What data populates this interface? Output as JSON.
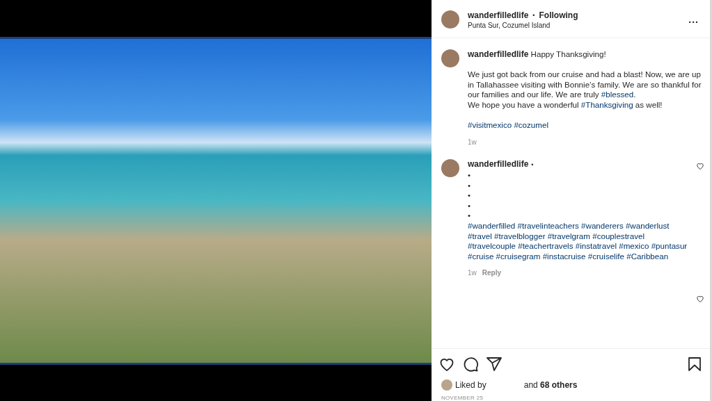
{
  "header": {
    "username": "wanderfilledlife",
    "separator": "•",
    "follow_status": "Following",
    "location": "Punta Sur, Cozumel Island",
    "menu": "..."
  },
  "comments": [
    {
      "username": "wanderfilledlife",
      "lines": [
        {
          "segments": [
            {
              "kind": "text",
              "text": "Happy Thanksgiving!"
            }
          ]
        },
        {
          "gap_before": true,
          "segments": [
            {
              "kind": "text",
              "text": "We just got back from our cruise and had a blast! Now, we are up in Tallahassee visiting with Bonnie’s family. We are so thankful for our families and our life. We are truly "
            },
            {
              "kind": "tag",
              "text": "#blessed"
            },
            {
              "kind": "text",
              "text": "."
            }
          ]
        },
        {
          "segments": [
            {
              "kind": "text",
              "text": "We hope you have a wonderful "
            },
            {
              "kind": "tag",
              "text": "#Thanksgiving"
            },
            {
              "kind": "text",
              "text": " as well!"
            }
          ]
        },
        {
          "gap_before": true,
          "segments": [
            {
              "kind": "tag",
              "text": "#visitmexico"
            },
            {
              "kind": "tag",
              "text": "#cozumel"
            }
          ]
        }
      ],
      "time": "1w"
    },
    {
      "username": "wanderfilledlife",
      "name_suffix": "•",
      "heart": {
        "liked": false
      },
      "lines": [
        {
          "segments": [
            {
              "kind": "text",
              "text": "•"
            }
          ]
        },
        {
          "segments": [
            {
              "kind": "text",
              "text": "•"
            }
          ]
        },
        {
          "segments": [
            {
              "kind": "text",
              "text": "•"
            }
          ]
        },
        {
          "segments": [
            {
              "kind": "text",
              "text": "•"
            }
          ]
        },
        {
          "segments": [
            {
              "kind": "text",
              "text": "•"
            }
          ]
        },
        {
          "segments": [
            {
              "kind": "tag",
              "text": "#wanderfilled"
            },
            {
              "kind": "tag",
              "text": "#travelinteachers"
            },
            {
              "kind": "tag",
              "text": "#wanderers"
            },
            {
              "kind": "tag",
              "text": "#wanderlust"
            },
            {
              "kind": "tag",
              "text": "#travel"
            },
            {
              "kind": "tag",
              "text": "#travelblogger"
            },
            {
              "kind": "tag",
              "text": "#travelgram"
            },
            {
              "kind": "tag",
              "text": "#couplestravel"
            },
            {
              "kind": "tag",
              "text": "#travelcouple"
            },
            {
              "kind": "tag",
              "text": "#teachertravels"
            },
            {
              "kind": "tag",
              "text": "#instatravel"
            },
            {
              "kind": "tag",
              "text": "#mexico"
            },
            {
              "kind": "tag",
              "text": "#puntasur"
            },
            {
              "kind": "tag",
              "text": "#cruise"
            },
            {
              "kind": "tag",
              "text": "#cruisegram"
            },
            {
              "kind": "tag",
              "text": "#instacruise"
            },
            {
              "kind": "tag",
              "text": "#cruiselife"
            },
            {
              "kind": "tag",
              "text": "#Caribbean"
            }
          ]
        }
      ],
      "time": "1w",
      "reply": "Reply"
    }
  ],
  "extra_heart": {
    "liked": false
  },
  "actions": {
    "liked": false,
    "saved": false
  },
  "likes": {
    "prefix": "Liked by",
    "suffix": "and **68 others**"
  },
  "date": "NOVEMBER 25"
}
